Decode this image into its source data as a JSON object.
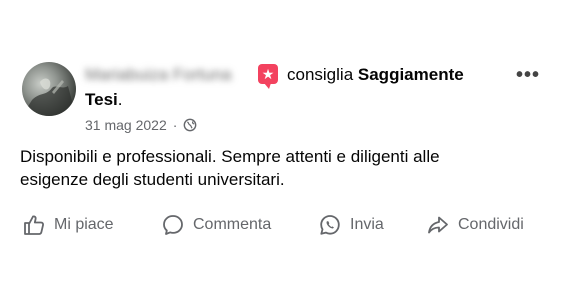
{
  "post": {
    "author_name": "Mariabuiza Fortuna",
    "recommend_icon": "recommend-icon",
    "verb": "consiglia",
    "business_name_part1": "Saggiamente",
    "business_name_part2": "Tesi",
    "business_name_suffix": ".",
    "more_label": "•••",
    "date": "31 mag 2022",
    "separator": "·",
    "privacy_icon": "globe-icon",
    "text_line1": "Disponibili e professionali. Sempre attenti e diligenti alle",
    "text_line2": "esigenze degli studenti universitari."
  },
  "actions": {
    "like": "Mi piace",
    "comment": "Commenta",
    "send": "Invia",
    "share": "Condividi"
  },
  "colors": {
    "recommend": "#f3425f",
    "secondary_text": "#65676b",
    "primary_text": "#050505"
  }
}
